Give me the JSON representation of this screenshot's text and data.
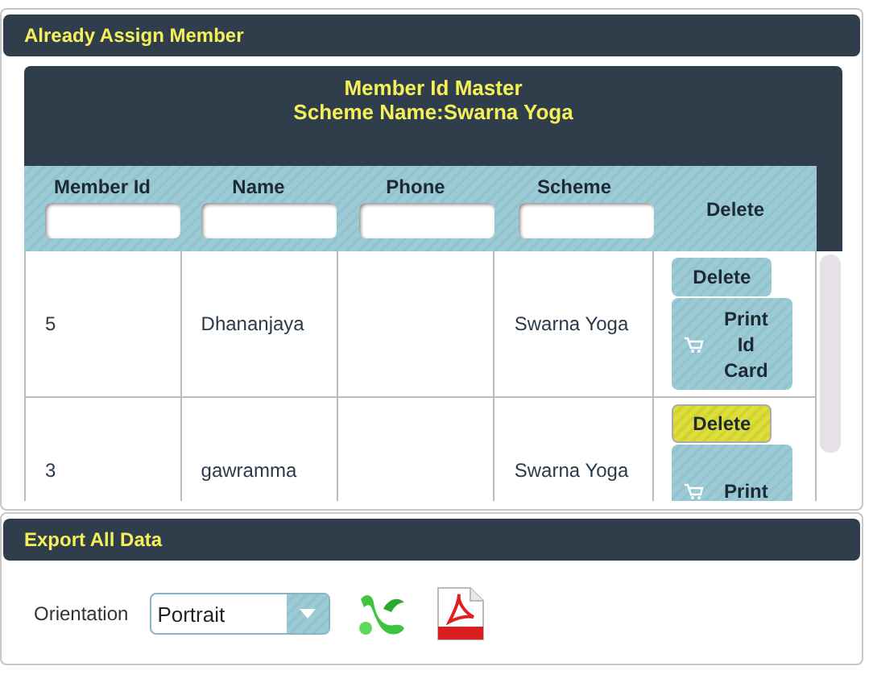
{
  "member_panel": {
    "title": "Already Assign Member",
    "table": {
      "title_lines": [
        "Member Id Master",
        "Scheme Name:Swarna Yoga"
      ],
      "columns": [
        {
          "label": "Member Id",
          "filter": true
        },
        {
          "label": "Name",
          "filter": true
        },
        {
          "label": "Phone",
          "filter": true
        },
        {
          "label": "Scheme",
          "filter": true
        },
        {
          "label": "Delete",
          "filter": false
        }
      ],
      "rows": [
        {
          "member_id": "5",
          "name": "Dhananjaya",
          "scheme": "Swarna Yoga",
          "delete_button": {
            "label": "Delete",
            "highlighted": false
          },
          "print_button": {
            "label": "Print Id Card"
          }
        },
        {
          "member_id": "3",
          "name": "gawramma",
          "scheme": "Swarna Yoga",
          "delete_button": {
            "label": "Delete",
            "highlighted": true
          },
          "print_button": {
            "label": "Print"
          }
        }
      ]
    }
  },
  "export_panel": {
    "title": "Export All Data",
    "orientation": {
      "label": "Orientation",
      "value": "Portrait"
    }
  }
}
